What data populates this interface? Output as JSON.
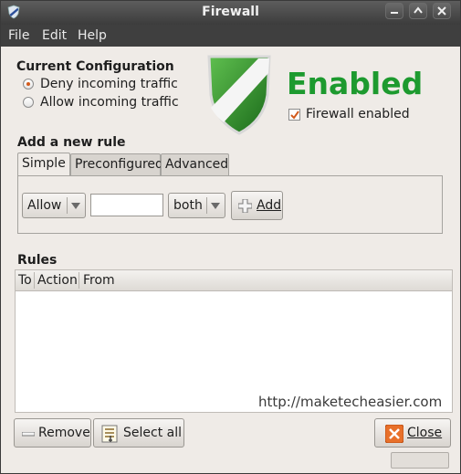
{
  "window": {
    "title": "Firewall"
  },
  "menu": {
    "file": "File",
    "edit": "Edit",
    "help": "Help"
  },
  "config": {
    "heading": "Current Configuration",
    "deny_label": "Deny incoming traffic",
    "allow_label": "Allow incoming traffic",
    "status": "Enabled",
    "enabled_label": "Firewall enabled",
    "deny_checked": true,
    "firewall_enabled": true
  },
  "add_rule": {
    "heading": "Add a new rule",
    "tabs": [
      "Simple",
      "Preconfigured",
      "Advanced"
    ],
    "action_value": "Allow",
    "port_value": "",
    "protocol_value": "both",
    "add_label": "Add"
  },
  "rules": {
    "heading": "Rules",
    "columns": [
      "To",
      "Action",
      "From"
    ],
    "rows": []
  },
  "watermark": "http://maketecheasier.com",
  "footer": {
    "remove_label": "Remove",
    "select_all_label": "Select all",
    "close_label": "Close"
  },
  "colors": {
    "status_green": "#1d9a2f",
    "shield_green": "#2a8a2a",
    "close_orange": "#e8702a"
  }
}
